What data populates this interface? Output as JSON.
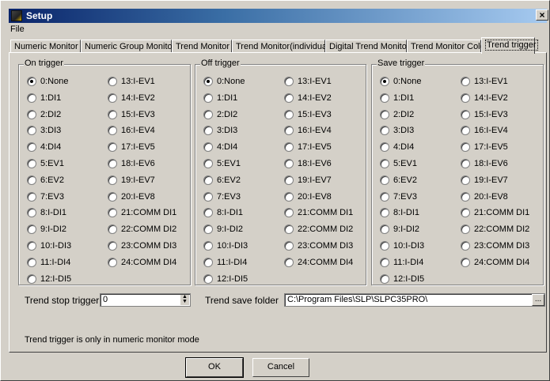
{
  "window": {
    "title": "Setup",
    "close_glyph": "×"
  },
  "menu": {
    "file": "File"
  },
  "tabs": [
    {
      "label": "Numeric Monitor"
    },
    {
      "label": "Numeric Group Monitor"
    },
    {
      "label": "Trend Monitor"
    },
    {
      "label": "Trend Monitor(individual)"
    },
    {
      "label": "Digital Trend Monitor"
    },
    {
      "label": "Trend Monitor Color"
    },
    {
      "label": "Trend trigger",
      "active": true
    }
  ],
  "groups": [
    {
      "title": "On trigger"
    },
    {
      "title": "Off trigger"
    },
    {
      "title": "Save trigger"
    }
  ],
  "trigger_options_left": [
    "0:None",
    "1:DI1",
    "2:DI2",
    "3:DI3",
    "4:DI4",
    "5:EV1",
    "6:EV2",
    "7:EV3",
    "8:I-DI1",
    "9:I-DI2",
    "10:I-DI3",
    "11:I-DI4",
    "12:I-DI5"
  ],
  "trigger_options_right": [
    "13:I-EV1",
    "14:I-EV2",
    "15:I-EV3",
    "16:I-EV4",
    "17:I-EV5",
    "18:I-EV6",
    "19:I-EV7",
    "20:I-EV8",
    "21:COMM DI1",
    "22:COMM DI2",
    "23:COMM DI3",
    "24:COMM DI4"
  ],
  "selected": {
    "on": "0:None",
    "off": "0:None",
    "save": "0:None"
  },
  "stop_trigger": {
    "label": "Trend stop trigger",
    "value": "0"
  },
  "save_folder": {
    "label": "Trend save folder",
    "value": "C:\\Program Files\\SLP\\SLPC35PRO\\",
    "browse": "..."
  },
  "note": "Trend trigger is only in numeric monitor mode",
  "buttons": {
    "ok": "OK",
    "cancel": "Cancel"
  }
}
